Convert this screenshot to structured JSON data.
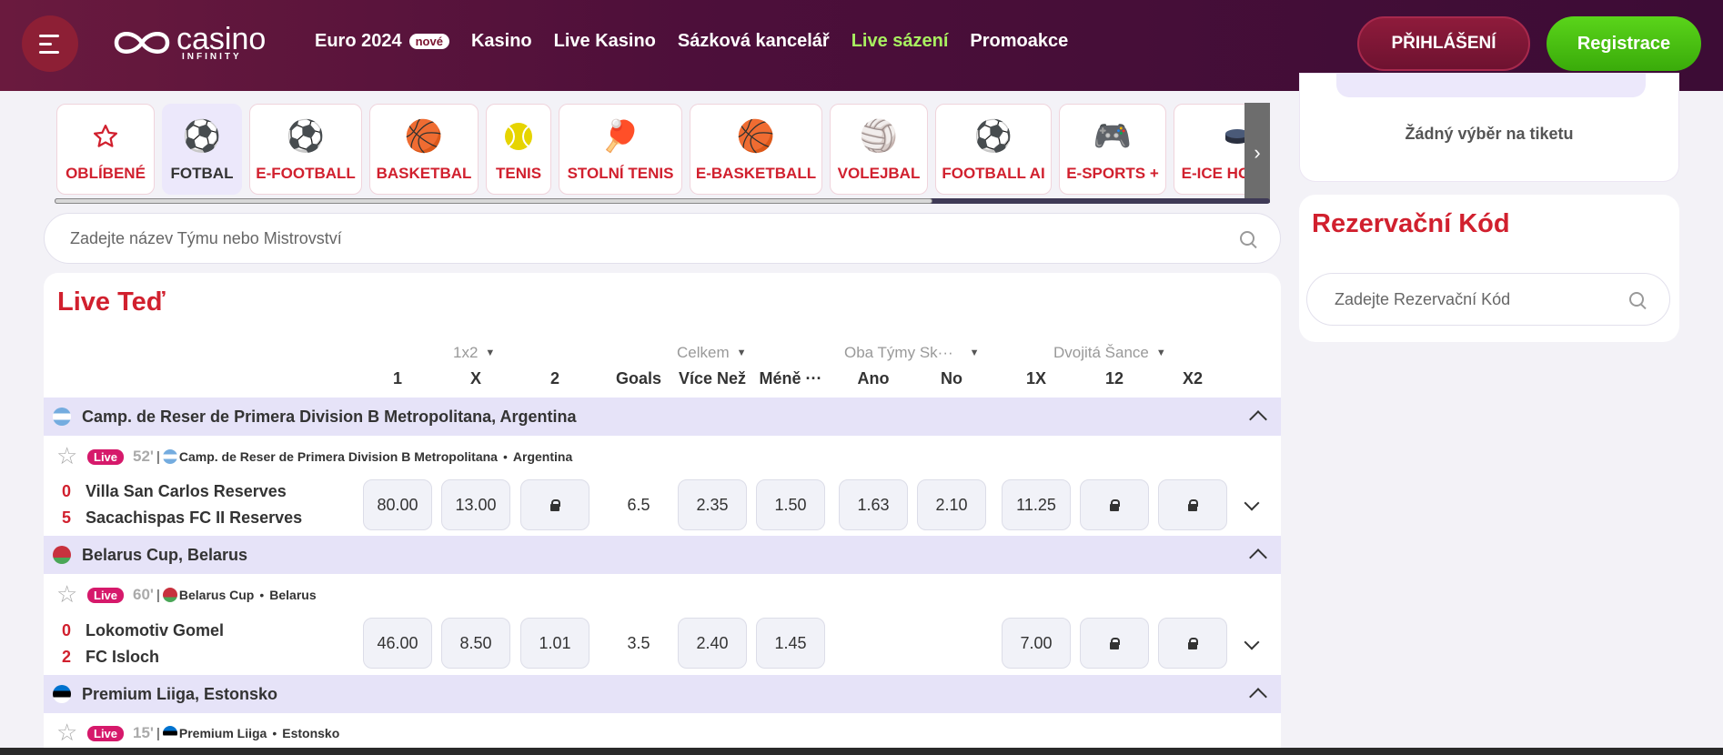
{
  "header": {
    "logo_word": "casino",
    "logo_sub": "INFINITY",
    "nav": [
      {
        "label": "Euro 2024",
        "badge": "nové",
        "active": false
      },
      {
        "label": "Kasino",
        "active": false
      },
      {
        "label": "Live Kasino",
        "active": false
      },
      {
        "label": "Sázková kancelář",
        "active": false
      },
      {
        "label": "Live sázení",
        "active": true
      },
      {
        "label": "Promoakce",
        "active": false
      }
    ],
    "login_label": "PŘIHLÁŠENÍ",
    "register_label": "Registrace"
  },
  "sports": [
    {
      "label": "OBLÍBENÉ",
      "icon": "star-icon",
      "active": false
    },
    {
      "label": "FOTBAL",
      "icon": "soccer-ball-icon",
      "active": true
    },
    {
      "label": "E-FOOTBALL",
      "icon": "soccer-ball-icon",
      "active": false
    },
    {
      "label": "BASKETBAL",
      "icon": "basketball-icon",
      "active": false
    },
    {
      "label": "TENIS",
      "icon": "tennis-ball-icon",
      "active": false
    },
    {
      "label": "STOLNÍ TENIS",
      "icon": "ping-pong-icon",
      "active": false
    },
    {
      "label": "E-BASKETBALL",
      "icon": "basketball-icon",
      "active": false
    },
    {
      "label": "VOLEJBAL",
      "icon": "volleyball-icon",
      "active": false
    },
    {
      "label": "FOOTBALL AI",
      "icon": "soccer-ball-icon",
      "active": false
    },
    {
      "label": "E-SPORTS +",
      "icon": "gamepad-icon",
      "active": false
    },
    {
      "label": "E-ICE HOCKEY",
      "icon": "hockey-puck-icon",
      "active": false
    }
  ],
  "search": {
    "placeholder": "Zadejte název Týmu nebo Mistrovství"
  },
  "live": {
    "title": "Live Teď",
    "groups": [
      {
        "label": "1x2"
      },
      {
        "label": "Celkem"
      },
      {
        "label": "Oba Týmy Sk···"
      },
      {
        "label": "Dvojitá Šance"
      }
    ],
    "columns": [
      "1",
      "X",
      "2",
      "Goals",
      "Více Než",
      "Méně ···",
      "Ano",
      "No",
      "1X",
      "12",
      "X2"
    ],
    "leagues": [
      {
        "name": "Camp. de Reser de Primera Division B Metropolitana, Argentina",
        "flag": "argentina",
        "match": {
          "live": "Live",
          "minute": "52'",
          "league_short": "Camp. de Reser de Primera Division B Metropolitana",
          "country": "Argentina",
          "home": {
            "score": "0",
            "name": "Villa San Carlos Reserves"
          },
          "away": {
            "score": "5",
            "name": "Sacachispas FC II Reserves"
          },
          "odds": {
            "1": "80.00",
            "X": "13.00",
            "2": "lock",
            "goals": "6.5",
            "over": "2.35",
            "under": "1.50",
            "yes": "1.63",
            "no": "2.10",
            "1X": "11.25",
            "12": "lock",
            "X2": "lock"
          }
        }
      },
      {
        "name": "Belarus Cup, Belarus",
        "flag": "belarus",
        "match": {
          "live": "Live",
          "minute": "60'",
          "league_short": "Belarus Cup",
          "country": "Belarus",
          "home": {
            "score": "0",
            "name": "Lokomotiv Gomel"
          },
          "away": {
            "score": "2",
            "name": "FC Isloch"
          },
          "odds": {
            "1": "46.00",
            "X": "8.50",
            "2": "1.01",
            "goals": "3.5",
            "over": "2.40",
            "under": "1.45",
            "1X": "7.00",
            "12": "lock",
            "X2": "lock"
          }
        }
      },
      {
        "name": "Premium Liiga, Estonsko",
        "flag": "estonia",
        "match": {
          "live": "Live",
          "minute": "15'",
          "league_short": "Premium Liiga",
          "country": "Estonsko"
        }
      }
    ]
  },
  "ticket": {
    "empty_text": "Žádný výběr na tiketu"
  },
  "reservation": {
    "title": "Rezervační Kód",
    "placeholder": "Zadejte Rezervační Kód"
  },
  "colors": {
    "accent_red": "#d1202e",
    "header_bg": "#4d0f3a",
    "live_green": "#a8f060",
    "register_green": "#46c010",
    "league_row": "#e6e3f8"
  }
}
